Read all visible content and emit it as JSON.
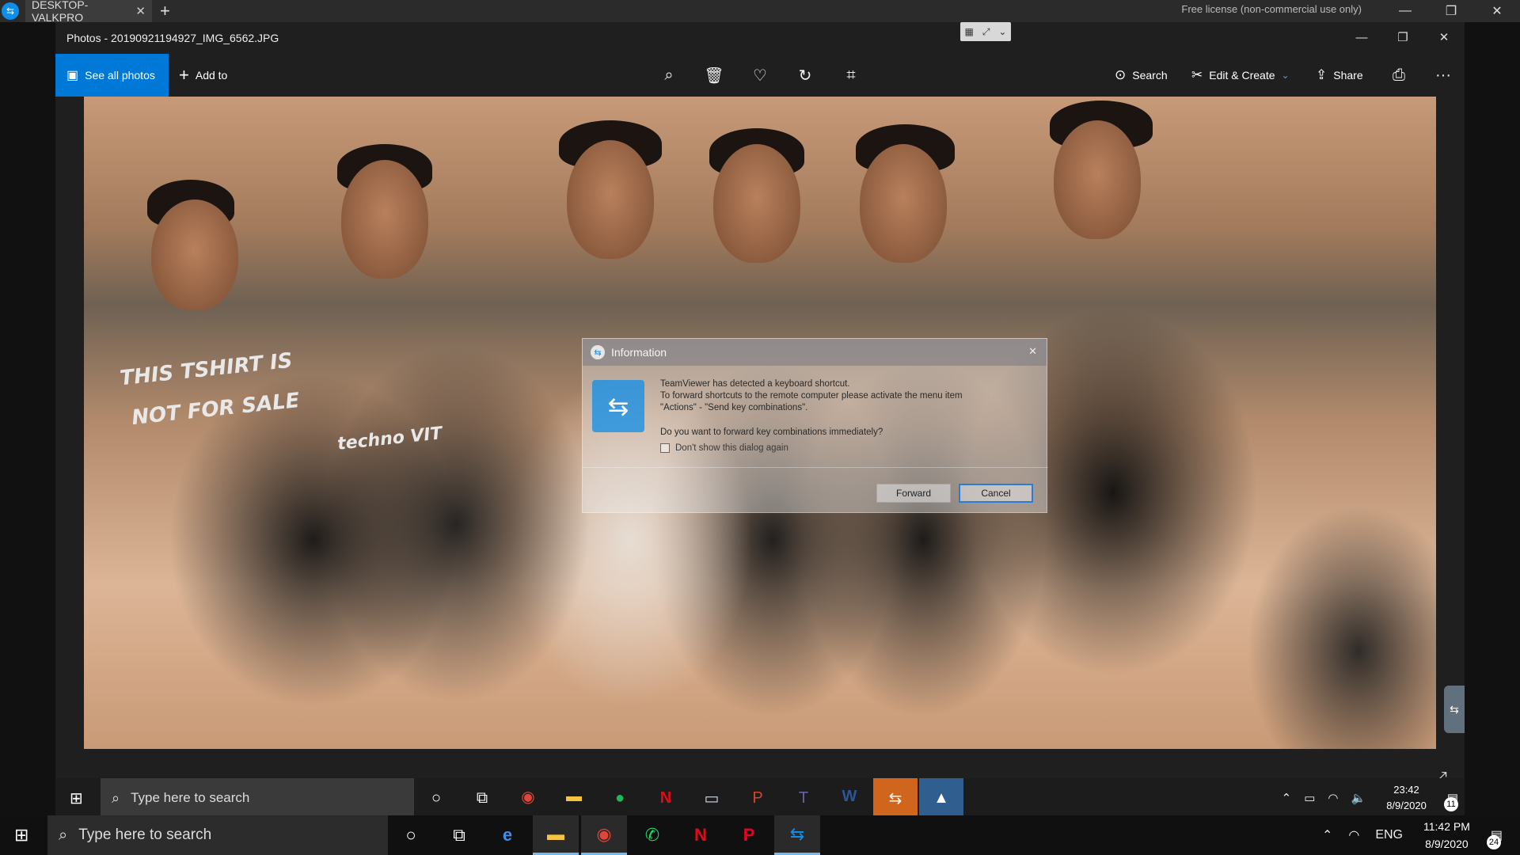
{
  "teamviewer": {
    "tab_label": "DESKTOP-VALKPRO",
    "tab_close": "✕",
    "new_tab": "+",
    "license": "Free license (non-commercial use only)",
    "window_buttons": [
      "—",
      "❐",
      "✕"
    ]
  },
  "photos": {
    "title": "Photos - 20190921194927_IMG_6562.JPG",
    "title_buttons": [
      "—",
      "❐",
      "✕"
    ],
    "see_all_label": "See all photos",
    "add_to_label": "Add to",
    "toolbar_icons": [
      "zoom-icon",
      "delete-icon",
      "favorite-icon",
      "rotate-icon",
      "crop-icon"
    ],
    "search_label": "Search",
    "edit_create_label": "Edit & Create",
    "share_label": "Share",
    "more_label": "···"
  },
  "photo_content": {
    "banner_text_1": "THIS TSHIRT IS",
    "banner_text_2": "NOT FOR SALE",
    "banner_text_3": "techno VIT"
  },
  "dialog": {
    "title": "Information",
    "close": "✕",
    "message_line1": "TeamViewer has detected a keyboard shortcut.",
    "message_line2": "To forward shortcuts to the remote computer please activate the menu item",
    "message_line3": "\"Actions\" - \"Send key combinations\".",
    "question": "Do you want to forward key combinations immediately?",
    "checkbox_label": "Don't show this dialog again",
    "forward_label": "Forward",
    "cancel_label": "Cancel"
  },
  "remote_taskbar": {
    "search_placeholder": "Type here to search",
    "time": "23:42",
    "date": "8/9/2020",
    "notifications": "11"
  },
  "local_taskbar": {
    "search_placeholder": "Type here to search",
    "language": "ENG",
    "time": "11:42 PM",
    "date": "8/9/2020",
    "notifications": "24"
  }
}
